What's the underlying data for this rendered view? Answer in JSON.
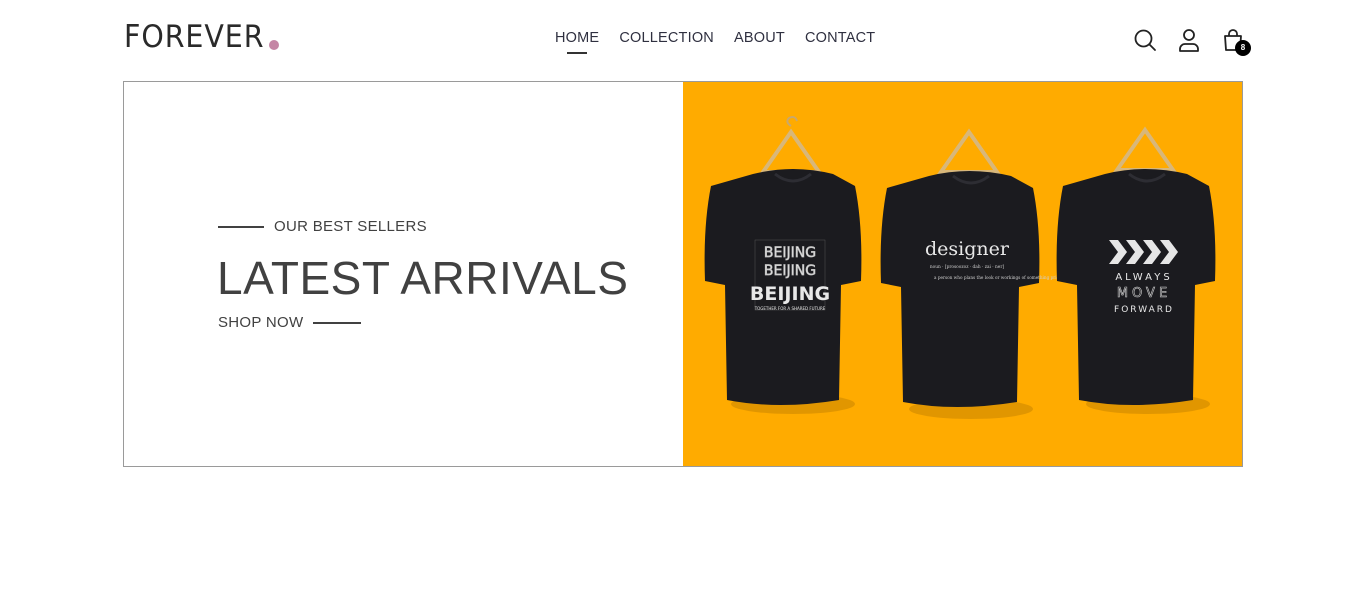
{
  "brand": {
    "name": "FOREVER",
    "dot_color": "#c586a5"
  },
  "nav": {
    "items": [
      {
        "label": "HOME",
        "active": true
      },
      {
        "label": "COLLECTION",
        "active": false
      },
      {
        "label": "ABOUT",
        "active": false
      },
      {
        "label": "CONTACT",
        "active": false
      }
    ]
  },
  "header_icons": {
    "search": "search-icon",
    "profile": "user-icon",
    "cart": "shopping-bag-icon",
    "cart_count": "8"
  },
  "hero": {
    "tagline": "OUR BEST SELLERS",
    "title": "LATEST ARRIVALS",
    "cta": "SHOP NOW",
    "image_bg": "#ffab00",
    "shirts": [
      {
        "print_main": "BEIJING",
        "print_sub": "TOGETHER FOR A SHARED FUTURE"
      },
      {
        "print_main": "designer",
        "print_sub": "noun · [prosoozoz · dah · zai · ner]",
        "print_body": "a person who plans the look or workings of something prior to it being made, by preparing drawings or plans."
      },
      {
        "print_main": "ALWAYS",
        "print_line2": "MOVE",
        "print_line3": "FORWARD"
      }
    ]
  },
  "colors": {
    "text": "#414141",
    "border": "#9a9a9a"
  }
}
